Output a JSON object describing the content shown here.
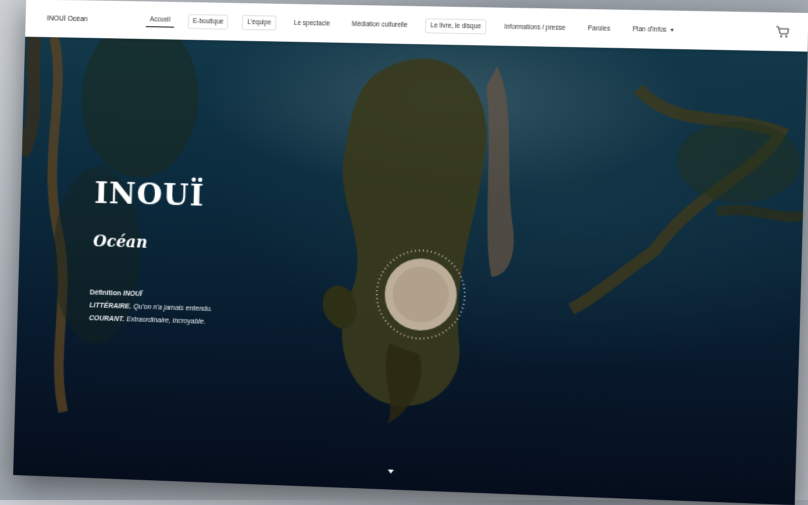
{
  "brand": "INOUÏ Océan",
  "nav": {
    "items": [
      {
        "label": "Accueil",
        "active": true
      },
      {
        "label": "E-boutique"
      },
      {
        "label": "L'équipe"
      },
      {
        "label": "Le spectacle"
      },
      {
        "label": "Médiation culturelle"
      },
      {
        "label": "Le livre, le disque"
      },
      {
        "label": "Informations / presse"
      },
      {
        "label": "Paroles"
      },
      {
        "label": "Plan d'infos",
        "dropdown": true
      }
    ],
    "cart_icon": "cart-icon"
  },
  "hero": {
    "title": "INOUÏ",
    "subtitle": "Océan",
    "definition": {
      "heading_label": "Définition",
      "heading_word": "INOUÏ",
      "line1_label": "LITTÉRAIRE.",
      "line1_text": "Qu'on n'a jamais entendu.",
      "line2_label": "COURANT.",
      "line2_text": "Extraordinaire, incroyable."
    },
    "scroll_icon": "chevron-down-icon"
  },
  "colors": {
    "navbar_bg": "#ffffff",
    "hero_deep": "#08192c",
    "text_light": "#ffffff"
  }
}
